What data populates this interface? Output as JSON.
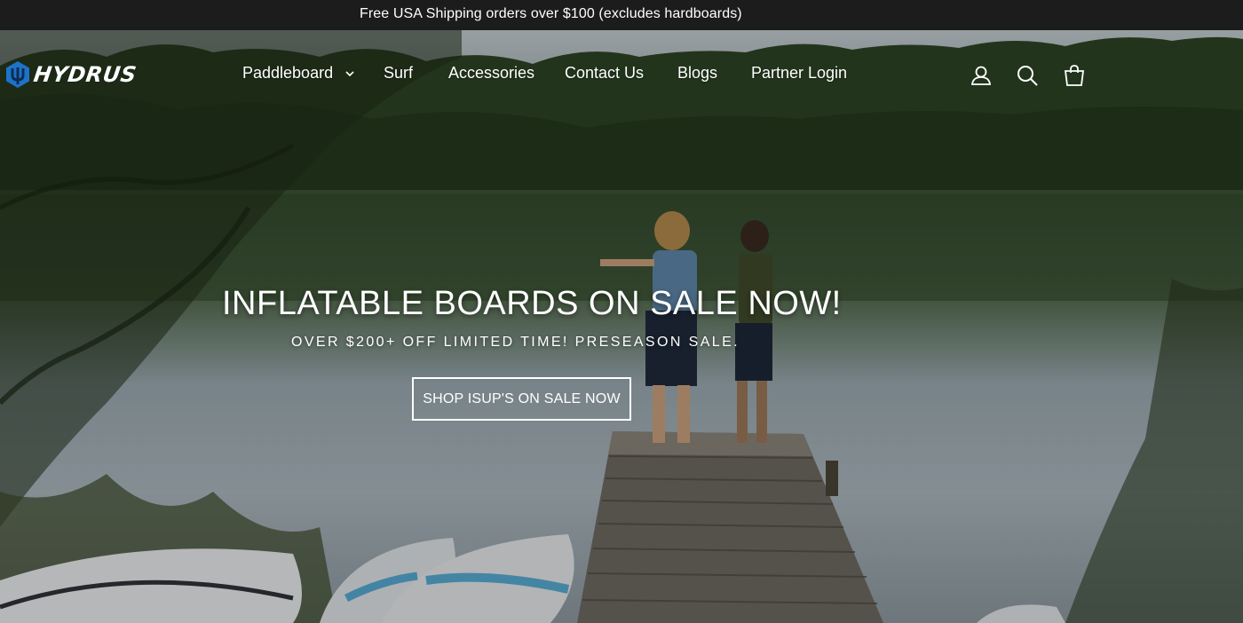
{
  "announcement": {
    "text": "Free USA Shipping orders over $100 (excludes hardboards)"
  },
  "brand": {
    "name": "HYDRUS",
    "accent": "#1e73c8"
  },
  "nav": {
    "items": [
      {
        "label": "Paddleboard",
        "has_dropdown": true
      },
      {
        "label": "Surf"
      },
      {
        "label": "Accessories"
      },
      {
        "label": "Contact Us"
      },
      {
        "label": "Blogs"
      },
      {
        "label": "Partner Login"
      }
    ],
    "icons": [
      "account-icon",
      "search-icon",
      "cart-icon"
    ]
  },
  "hero": {
    "title": "INFLATABLE BOARDS ON SALE NOW!",
    "subtitle": "OVER $200+ OFF LIMITED TIME! PRESEASON SALE.",
    "cta_label": "SHOP ISUP'S ON SALE NOW"
  }
}
